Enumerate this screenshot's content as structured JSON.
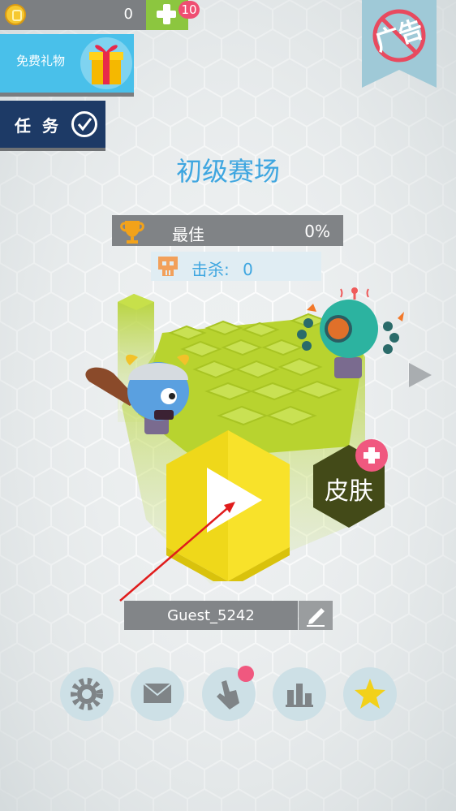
{
  "top_bar": {
    "coins": "0",
    "add_badge": "10"
  },
  "side_buttons": {
    "gift_label": "免费礼物",
    "quest_label": "任务",
    "no_ads_label": "广告"
  },
  "arena_title": "初级赛场",
  "stats": {
    "best_label": "最佳",
    "best_value": "0%",
    "kills_label": "击杀:",
    "kills_value": "0"
  },
  "skins": {
    "label": "皮肤"
  },
  "player": {
    "name": "Guest_5242"
  },
  "dock": {
    "items": [
      {
        "icon": "gear-icon"
      },
      {
        "icon": "mail-icon"
      },
      {
        "icon": "tap-hand-icon"
      },
      {
        "icon": "leaderboard-icon"
      },
      {
        "icon": "star-icon"
      }
    ]
  },
  "colors": {
    "accent_blue": "#3ea6e0",
    "hex_green": "#b7d334",
    "play_yellow": "#f7e21f",
    "badge_pink": "#f0587f",
    "skins_dark": "#434a18"
  }
}
